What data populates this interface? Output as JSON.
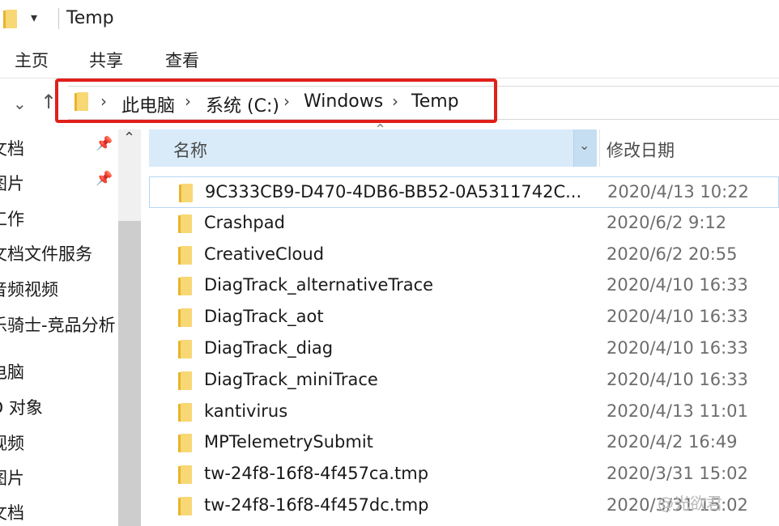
{
  "window": {
    "title": "Temp"
  },
  "ribbon": {
    "tabs": [
      "主页",
      "共享",
      "查看"
    ]
  },
  "nav": {
    "back_icon": "chevron-down-icon",
    "up_icon": "up-arrow-icon"
  },
  "address_bar": {
    "crumbs": [
      "此电脑",
      "系统 (C:)",
      "Windows",
      "Temp"
    ],
    "highlight_color": "#e0201c"
  },
  "sidebar": {
    "items": [
      {
        "label": "文档",
        "pinned": true
      },
      {
        "label": "图片",
        "pinned": true
      },
      {
        "label": "工作",
        "pinned": false
      },
      {
        "label": "文档文件服务",
        "pinned": false
      },
      {
        "label": "音频视频",
        "pinned": false
      },
      {
        "label": "乐骑士-竞品分析",
        "pinned": false
      },
      {
        "label": "电脑",
        "pinned": false
      },
      {
        "label": "D 对象",
        "pinned": false
      },
      {
        "label": "视频",
        "pinned": false
      },
      {
        "label": "图片",
        "pinned": false
      },
      {
        "label": "文档",
        "pinned": false
      }
    ]
  },
  "file_list": {
    "columns": {
      "name": "名称",
      "date": "修改日期"
    },
    "rows": [
      {
        "name": "9C333CB9-D470-4DB6-BB52-0A5311742C...",
        "date": "2020/4/13 10:22"
      },
      {
        "name": "Crashpad",
        "date": "2020/6/2 9:12"
      },
      {
        "name": "CreativeCloud",
        "date": "2020/6/2 20:55"
      },
      {
        "name": "DiagTrack_alternativeTrace",
        "date": "2020/4/10 16:33"
      },
      {
        "name": "DiagTrack_aot",
        "date": "2020/4/10 16:33"
      },
      {
        "name": "DiagTrack_diag",
        "date": "2020/4/10 16:33"
      },
      {
        "name": "DiagTrack_miniTrace",
        "date": "2020/4/10 16:33"
      },
      {
        "name": "kantivirus",
        "date": "2020/4/13 11:01"
      },
      {
        "name": "MPTelemetrySubmit",
        "date": "2020/4/2 16:49"
      },
      {
        "name": "tw-24f8-16f8-4f457ca.tmp",
        "date": "2020/3/31 15:02"
      },
      {
        "name": "tw-24f8-16f8-4f457dc.tmp",
        "date": "2020/3/31 15:02"
      }
    ]
  },
  "watermark": "@光欲君"
}
